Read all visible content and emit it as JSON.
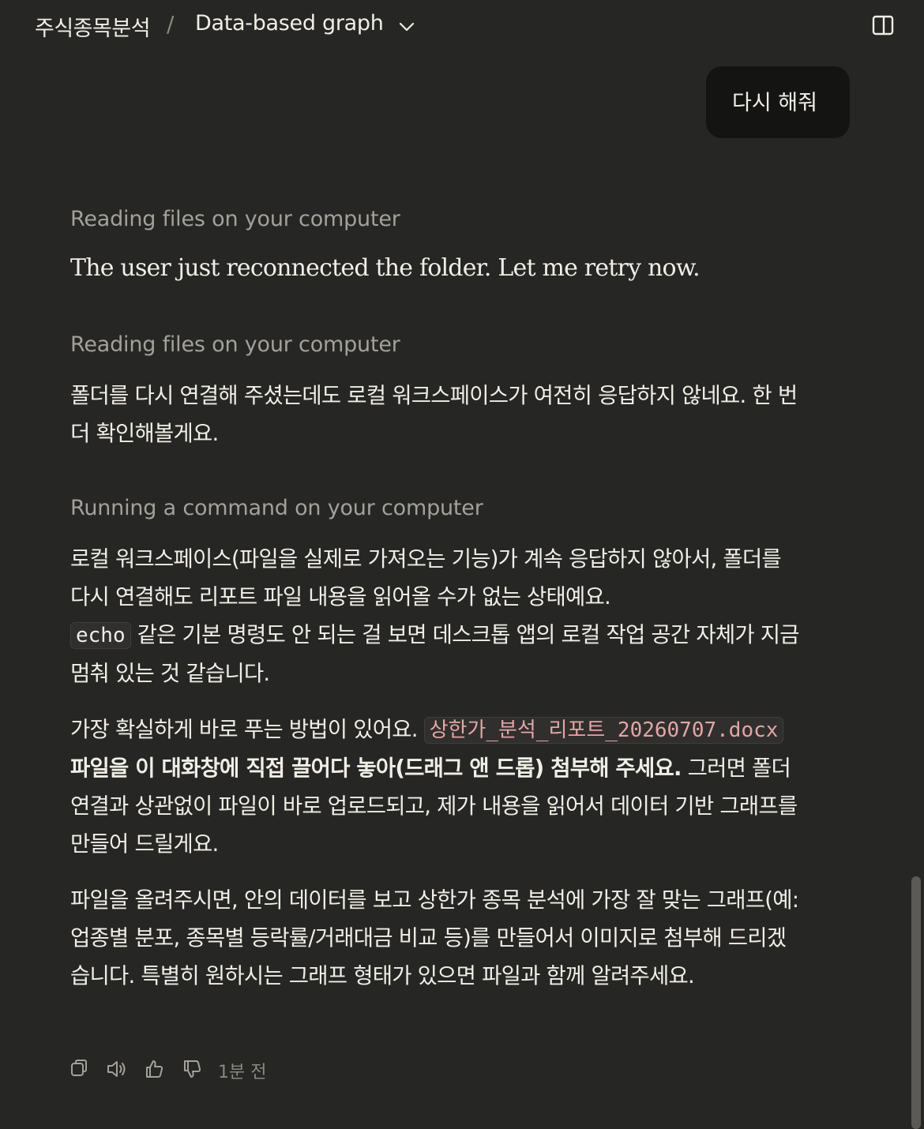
{
  "header": {
    "project": "주식종목분석",
    "separator": "/",
    "chat_title": "Data-based graph"
  },
  "user_message": "다시 해줘",
  "steps": [
    "Reading files on your computer",
    "Reading files on your computer",
    "Running a command on your computer"
  ],
  "thought": "The user just reconnected the folder. Let me retry now.",
  "reply1": "폴더를 다시 연결해 주셨는데도 로컬 워크스페이스가 여전히 응답하지 않네요. 한 번 더 확인해볼게요.",
  "reply2": {
    "line1": "로컬 워크스페이스(파일을 실제로 가져오는 기능)가 계속 응답하지 않아서, 폴더를 다시 연결해도 리포트 파일 내용을 읽어올 수가 없는 상태예요.",
    "code": "echo",
    "line2": " 같은 기본 명령도 안 되는 걸 보면 데스크톱 앱의 로컬 작업 공간 자체가 지금 멈춰 있는 것 같습니다."
  },
  "reply3": {
    "pre": "가장 확실하게 바로 푸는 방법이 있어요. ",
    "file": "상한가_분석_리포트_20260707.docx",
    "bold": " 파일을 이 대화창에 직접 끌어다 놓아(드래그 앤 드롭) 첨부해 주세요.",
    "post": " 그러면 폴더 연결과 상관없이 파일이 바로 업로드되고, 제가 내용을 읽어서 데이터 기반 그래프를 만들어 드릴게요."
  },
  "reply4": "파일을 올려주시면, 안의 데이터를 보고 상한가 종목 분석에 가장 잘 맞는 그래프(예: 업종별 분포, 종목별 등락률/거래대금 비교 등)를 만들어서 이미지로 첨부해 드리겠습니다. 특별히 원하시는 그래프 형태가 있으면 파일과 함께 알려주세요.",
  "actions": {
    "icons": [
      "copy-icon",
      "speaker-icon",
      "thumbs-up-icon",
      "thumbs-down-icon"
    ],
    "time": "1분 전"
  }
}
